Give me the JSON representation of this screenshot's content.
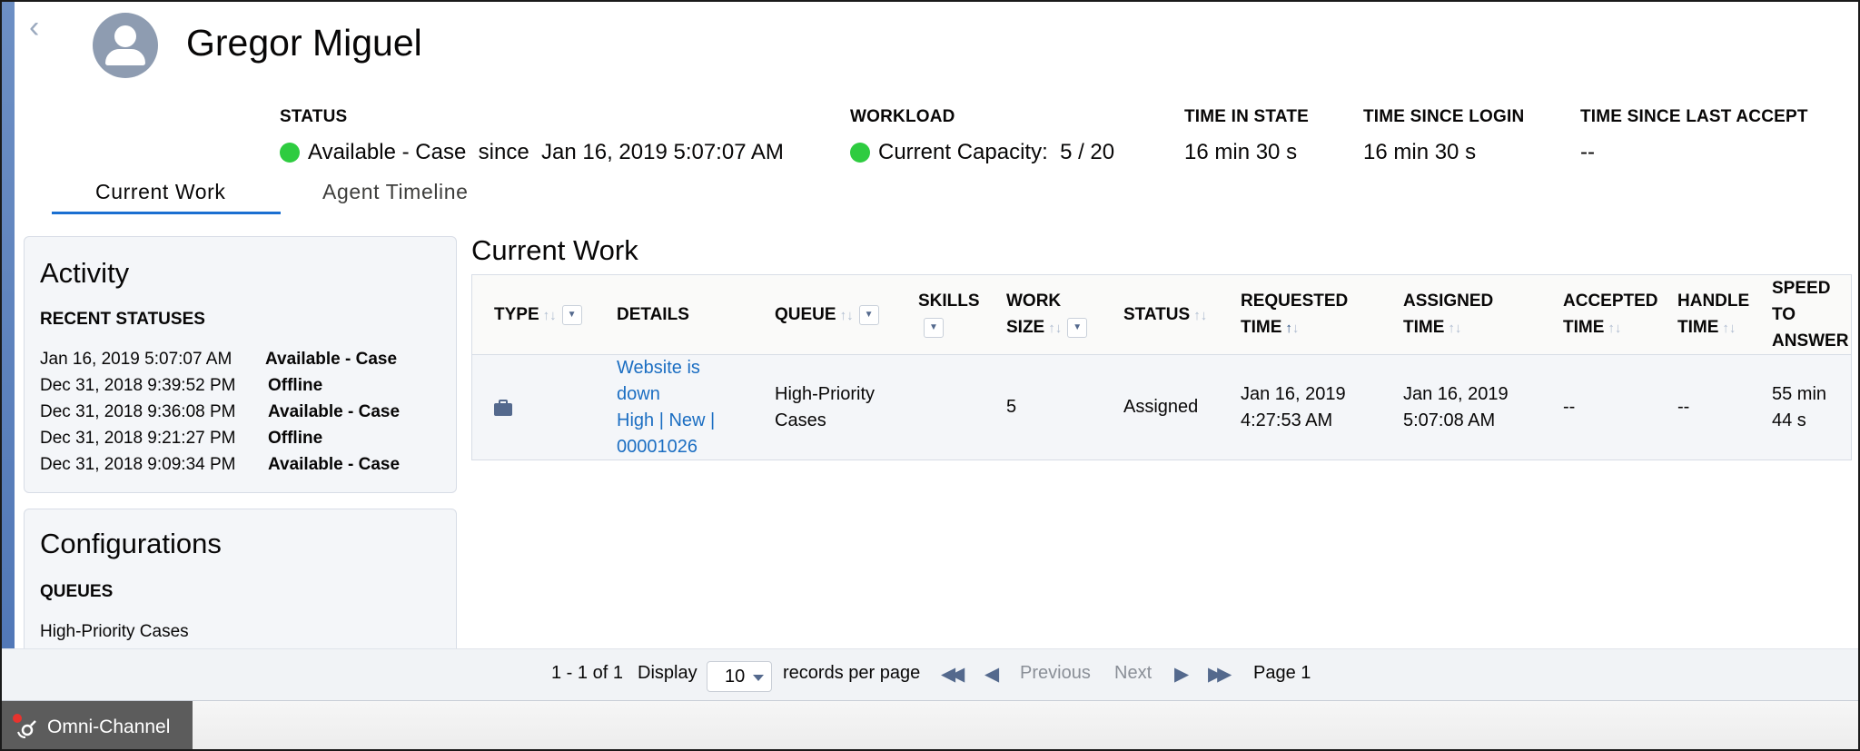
{
  "header": {
    "back_glyph": "‹",
    "agent_name": "Gregor Miguel"
  },
  "stats": {
    "status": {
      "label": "STATUS",
      "value": "Available - Case  since  Jan 16, 2019 5:07:07 AM",
      "dot_color": "#2ecc40"
    },
    "workload": {
      "label": "WORKLOAD",
      "value": "Current Capacity:  5 / 20",
      "dot_color": "#2ecc40"
    },
    "time_in_state": {
      "label": "TIME IN STATE",
      "value": "16 min 30 s"
    },
    "time_since_login": {
      "label": "TIME SINCE LOGIN",
      "value": "16 min 30 s"
    },
    "time_since_last_accept": {
      "label": "TIME SINCE LAST ACCEPT",
      "value": "--"
    }
  },
  "tabs": [
    {
      "label": "Current Work",
      "active": true
    },
    {
      "label": "Agent Timeline",
      "active": false
    }
  ],
  "activity": {
    "title": "Activity",
    "subtitle": "RECENT STATUSES",
    "statuses": [
      {
        "time": "Jan 16, 2019 5:07:07 AM",
        "status": "Available - Case"
      },
      {
        "time": "Dec 31, 2018 9:39:52 PM",
        "status": "Offline"
      },
      {
        "time": "Dec 31, 2018 9:36:08 PM",
        "status": "Available - Case"
      },
      {
        "time": "Dec 31, 2018 9:21:27 PM",
        "status": "Offline"
      },
      {
        "time": "Dec 31, 2018 9:09:34 PM",
        "status": "Available - Case"
      }
    ]
  },
  "configurations": {
    "title": "Configurations",
    "subtitle": "QUEUES",
    "queue": "High-Priority Cases"
  },
  "current_work": {
    "title": "Current Work",
    "columns": {
      "type": "TYPE",
      "details": "DETAILS",
      "queue": "QUEUE",
      "skills": "SKILLS",
      "work_size_1": "WORK",
      "work_size_2": "SIZE",
      "status": "STATUS",
      "requested_1": "REQUESTED",
      "requested_2": "TIME",
      "assigned_1": "ASSIGNED",
      "assigned_2": "TIME",
      "accepted_1": "ACCEPTED",
      "accepted_2": "TIME",
      "handle_1": "HANDLE",
      "handle_2": "TIME",
      "speed_1": "SPEED",
      "speed_2": "TO",
      "speed_3": "ANSWER"
    },
    "sort_glyph": "↑↓",
    "sort_up": "↑",
    "sort_down": "↓",
    "filter_glyph": "▼",
    "rows": [
      {
        "type_icon": "briefcase-icon",
        "details_line1": "Website is",
        "details_line2": "down",
        "details_line3": "High | New |",
        "details_line4": "00001026",
        "queue_line1": "High-Priority",
        "queue_line2": "Cases",
        "work_size": "5",
        "status": "Assigned",
        "requested_line1": "Jan 16, 2019",
        "requested_line2": "4:27:53 AM",
        "assigned_line1": "Jan 16, 2019",
        "assigned_line2": "5:07:08 AM",
        "accepted": "--",
        "handle": "--",
        "speed_line1": "55 min",
        "speed_line2": "44 s"
      }
    ]
  },
  "pager": {
    "range": "1 - 1 of 1",
    "display_label": "Display",
    "per_page_value": "10",
    "per_page_label": "records per page",
    "first_glyph": "◀◀",
    "prev_glyph": "◀",
    "prev_label": "Previous",
    "next_label": "Next",
    "next_glyph": "▶",
    "last_glyph": "▶▶",
    "page_label": "Page 1"
  },
  "utility_bar": {
    "omni_label": "Omni-Channel",
    "badge_color": "#e8332e"
  }
}
